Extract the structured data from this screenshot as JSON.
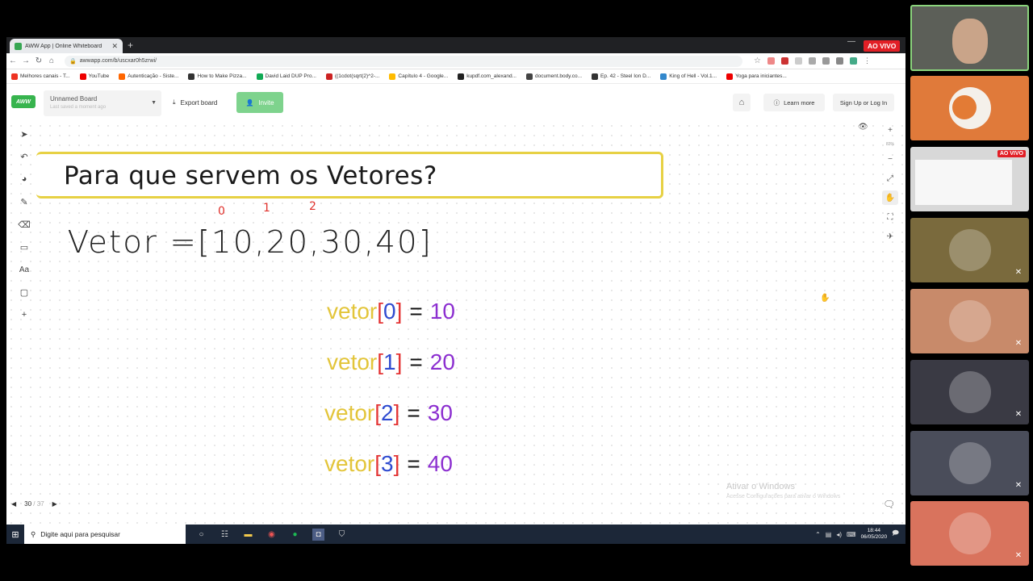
{
  "browser": {
    "tab_title": "AWW App | Online Whiteboard",
    "url": "awwapp.com/b/uscxar0h5zrwi/",
    "bookmarks": [
      {
        "label": "Melhores canais - T...",
        "color": "#e32"
      },
      {
        "label": "YouTube",
        "color": "#e00"
      },
      {
        "label": "Autenticação - Siste...",
        "color": "#f60"
      },
      {
        "label": "How to Make Pizza...",
        "color": "#333"
      },
      {
        "label": "David Laid DUP Pro...",
        "color": "#1a5"
      },
      {
        "label": "((1cdot(sqrt(2)^2-...",
        "color": "#c22"
      },
      {
        "label": "Capítulo 4 - Google...",
        "color": "#fb0"
      },
      {
        "label": "kupdf.com_alexand...",
        "color": "#222"
      },
      {
        "label": "document.body.co...",
        "color": "#444"
      },
      {
        "label": "Ep. 42 - Steel Ion D...",
        "color": "#333"
      },
      {
        "label": "King of Hell - Vol.1...",
        "color": "#38c"
      },
      {
        "label": "Yoga para iniciantes...",
        "color": "#e00"
      }
    ]
  },
  "toolbar": {
    "logo": "AWW",
    "board_name": "Unnamed Board",
    "board_sub": "Last saved a moment ago",
    "export_label": "Export board",
    "invite_label": "Invite",
    "learn_label": "Learn more",
    "signup_label": "Sign Up or Log In"
  },
  "canvas": {
    "title": "Para que servem os Vetores?",
    "handwritten": "Vetor =[10,20,30,40]",
    "indices": [
      "0",
      "1",
      "2"
    ],
    "lines": [
      {
        "kw": "vetor",
        "open": "[",
        "idx": "0",
        "close": "]",
        "eq": "=",
        "val": "10"
      },
      {
        "kw": "vetor",
        "open": "[",
        "idx": "1",
        "close": "]",
        "eq": "=",
        "val": "20"
      },
      {
        "kw": "vetor",
        "open": "[",
        "idx": "2",
        "close": "]",
        "eq": "=",
        "val": "30"
      },
      {
        "kw": "vetor",
        "open": "[",
        "idx": "3",
        "close": "]",
        "eq": "=",
        "val": "40"
      }
    ],
    "zoom": "83%",
    "page_current": "30",
    "page_total": "/ 37",
    "activate_title": "Ativar o Windows",
    "activate_sub": "Acesse Configurações para ativar o Windows"
  },
  "taskbar": {
    "search_placeholder": "Digite aqui para pesquisar",
    "time": "18:44",
    "date": "06/05/2020"
  },
  "stream": {
    "live_label": "AO VIVO",
    "mini_live_label": "AO VIVO"
  },
  "participants": [
    {
      "kind": "self",
      "color": "#5c5f58"
    },
    {
      "kind": "avatar",
      "color": "#e07a3a"
    },
    {
      "kind": "screen",
      "color": "#d8d8d8"
    },
    {
      "kind": "person",
      "color": "#7a6a3d"
    },
    {
      "kind": "person",
      "color": "#c88a6a"
    },
    {
      "kind": "person",
      "color": "#3a3a44"
    },
    {
      "kind": "person",
      "color": "#4a4d5a"
    },
    {
      "kind": "person",
      "color": "#d9735d"
    }
  ]
}
